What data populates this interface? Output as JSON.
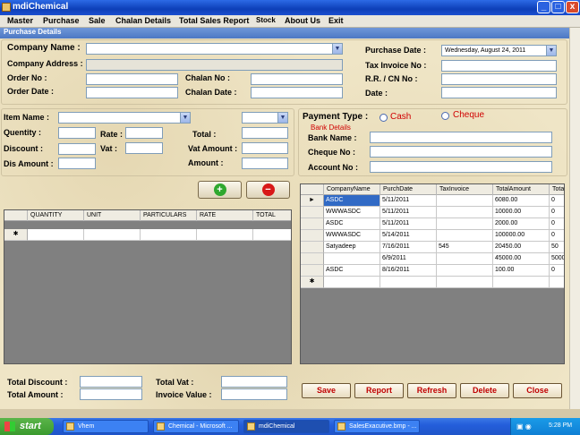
{
  "window": {
    "title": "mdiChemical",
    "minimize": "_",
    "maximize": "□",
    "close": "x"
  },
  "menu": [
    "Master",
    "Purchase",
    "Sale",
    "Chalan Details",
    "Total Sales Report",
    "Stock",
    "About Us",
    "Exit"
  ],
  "child_title": "Purchase Details",
  "header": {
    "company_name_label": "Company Name :",
    "company_address_label": "Company Address :",
    "order_no_label": "Order No :",
    "order_date_label": "Order Date :",
    "chalan_no_label": "Chalan No :",
    "chalan_date_label": "Chalan Date :",
    "purchase_date_label": "Purchase Date :",
    "purchase_date_value": "Wednesday,   August   24, 2011",
    "tax_invoice_label": "Tax Invoice No :",
    "rr_cn_label": "R.R. / CN No :",
    "date_label": "Date :"
  },
  "item": {
    "item_name_label": "Item Name :",
    "quantity_label": "Quentity :",
    "rate_label": "Rate :",
    "total_label": "Total :",
    "discount_label": "Discount :",
    "vat_label": "Vat :",
    "vat_amount_label": "Vat Amount :",
    "dis_amount_label": "Dis Amount :",
    "amount_label": "Amount :"
  },
  "payment": {
    "label": "Payment Type :",
    "cash": "Cash",
    "cheque": "Cheque",
    "bank_details": "Bank Details",
    "bank_name_label": "Bank Name :",
    "cheque_no_label": "Cheque No :",
    "account_no_label": "Account No :"
  },
  "items_grid": {
    "columns": [
      "QUANTITY",
      "UNIT",
      "PARTICULARS",
      "RATE",
      "TOTAL"
    ],
    "new_row_marker": "✱"
  },
  "purchases_grid": {
    "columns": [
      "CompanyName",
      "PurchDate",
      "TaxInvoice",
      "TotalAmount",
      "Tota"
    ],
    "rows": [
      [
        "ASDC",
        "5/11/2011",
        "",
        "6080.00",
        "0"
      ],
      [
        "WWWASDC",
        "5/11/2011",
        "",
        "10000.00",
        "0"
      ],
      [
        "ASDC",
        "5/11/2011",
        "",
        "2000.00",
        "0"
      ],
      [
        "WWWASDC",
        "5/14/2011",
        "",
        "100000.00",
        "0"
      ],
      [
        "Satyadeep",
        "7/16/2011",
        "545",
        "20450.00",
        "50"
      ],
      [
        "",
        "6/9/2011",
        "",
        "45000.00",
        "5000"
      ],
      [
        "ASDC",
        "8/16/2011",
        "",
        "100.00",
        "0"
      ]
    ],
    "current_marker": "►",
    "new_row_marker": "✱"
  },
  "totals": {
    "total_discount_label": "Total Discount :",
    "total_amount_label": "Total Amount :",
    "total_vat_label": "Total Vat :",
    "invoice_value_label": "Invoice Value :"
  },
  "actions": [
    "Save",
    "Report",
    "Refresh",
    "Delete",
    "Close"
  ],
  "taskbar": {
    "start": "start",
    "tasks": [
      "Vhem",
      "Chemical - Microsoft ...",
      "mdiChemical",
      "SalesExacutive.bmp - ..."
    ],
    "clock": "5:28 PM"
  },
  "colors": {
    "accent_red": "#d00000",
    "selection": "#316ac5",
    "add_icon": "#2fa82f",
    "remove_icon": "#d81818"
  }
}
